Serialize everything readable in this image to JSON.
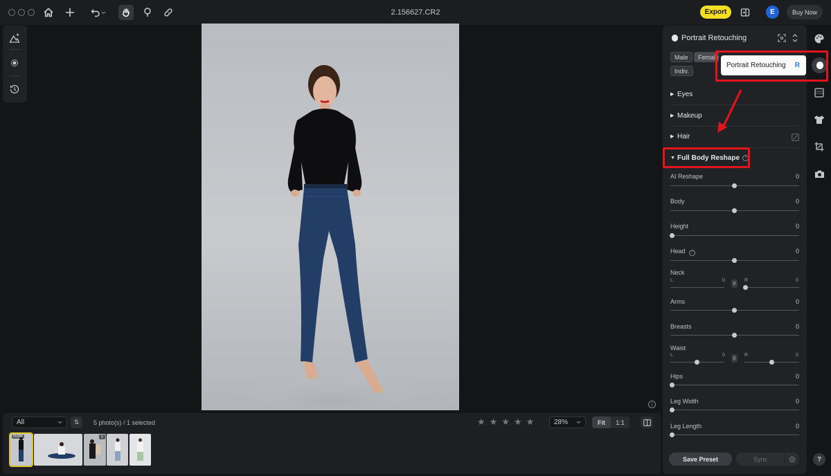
{
  "titlebar": {
    "filename": "2.156627.CR2",
    "export_label": "Export",
    "avatar_initial": "E",
    "buy_label": "Buy Now"
  },
  "filmstrip": {
    "filter_value": "All",
    "sort_label": "⇅",
    "count_text": "5 photo(s) / 1 selected",
    "rating_stars": 5,
    "zoom_value": "28%",
    "fit_label": "Fit",
    "one_to_one_label": "1:1",
    "thumb_badge": "RAW"
  },
  "panel": {
    "title": "Portrait Retouching",
    "chips": [
      "Male",
      "Female",
      "Indiv."
    ],
    "sections": {
      "eyes": "Eyes",
      "makeup": "Makeup",
      "hair": "Hair",
      "full_body": "Full Body Reshape"
    },
    "sliders": [
      {
        "label": "AI Reshape",
        "value": "0",
        "position": 0.5
      },
      {
        "label": "Body",
        "value": "0",
        "position": 0.5
      },
      {
        "label": "Height",
        "value": "0",
        "position": 0.0
      },
      {
        "label": "Head",
        "value": "0",
        "position": 0.5
      },
      {
        "label": "Neck",
        "value": "0"
      },
      {
        "label": "Arms",
        "value": "0",
        "position": 0.5
      },
      {
        "label": "Breasts",
        "value": "0",
        "position": 0.5
      },
      {
        "label": "Waist",
        "value": "0"
      },
      {
        "label": "Hips",
        "value": "0",
        "position": 0.0
      },
      {
        "label": "Leg Width",
        "value": "0",
        "position": 0.0
      },
      {
        "label": "Leg Length",
        "value": "0",
        "position": 0.0
      }
    ],
    "neck": {
      "left_label": "L",
      "left_value": "0",
      "right_label": "R",
      "right_value": "0"
    },
    "waist": {
      "left_label": "L",
      "left_value": "0",
      "right_label": "R",
      "right_value": "0"
    },
    "save_preset_label": "Save Preset",
    "sync_label": "Sync"
  },
  "tooltip": {
    "label": "Portrait Retouching",
    "shortcut": "R"
  },
  "colors": {
    "accent_yellow": "#f4de23",
    "highlight_red": "#e3151b",
    "avatar_blue": "#1f63d6",
    "shortcut_blue": "#2f7be0"
  },
  "help_label": "?"
}
